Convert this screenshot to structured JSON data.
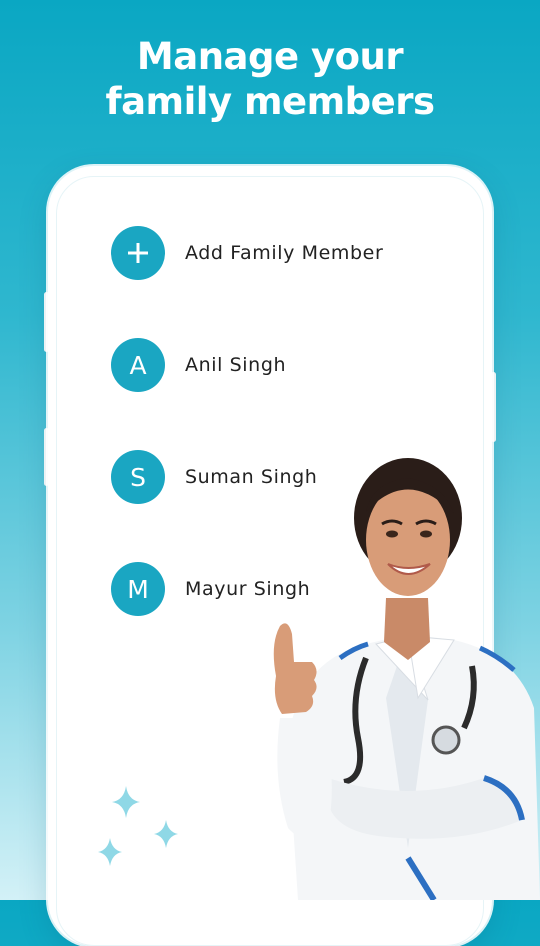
{
  "headline": {
    "line1": "Manage your",
    "line2": "family members"
  },
  "members": [
    {
      "avatar": "+",
      "label": "Add Family Member",
      "icon": "plus-icon"
    },
    {
      "avatar": "A",
      "label": "Anil Singh"
    },
    {
      "avatar": "S",
      "label": "Suman Singh"
    },
    {
      "avatar": "M",
      "label": "Mayur Singh"
    }
  ],
  "colors": {
    "accent": "#1aa6c2",
    "background_top": "#0aa7c3",
    "background_bottom": "#d3f1f7"
  }
}
